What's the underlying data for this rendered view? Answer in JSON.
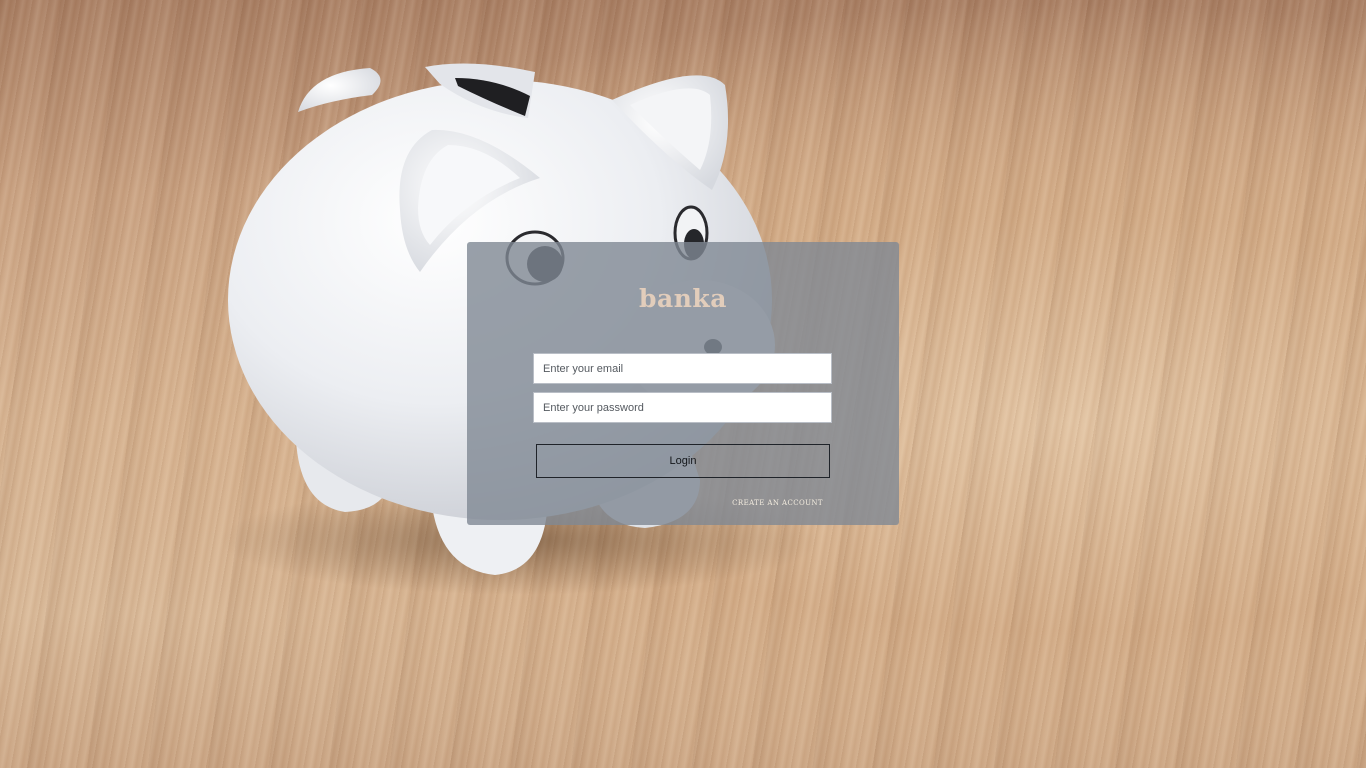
{
  "login": {
    "brand": "banka",
    "email_placeholder": "Enter your email",
    "email_value": "",
    "password_placeholder": "Enter your password",
    "password_value": "",
    "login_label": "Login",
    "create_account_label": "CREATE AN ACCOUNT"
  },
  "colors": {
    "overlay": "#808894",
    "brand_text": "#e2cdbb",
    "wood_background": "#d2ab86"
  },
  "icons": {
    "background": "piggy-bank-photo"
  }
}
